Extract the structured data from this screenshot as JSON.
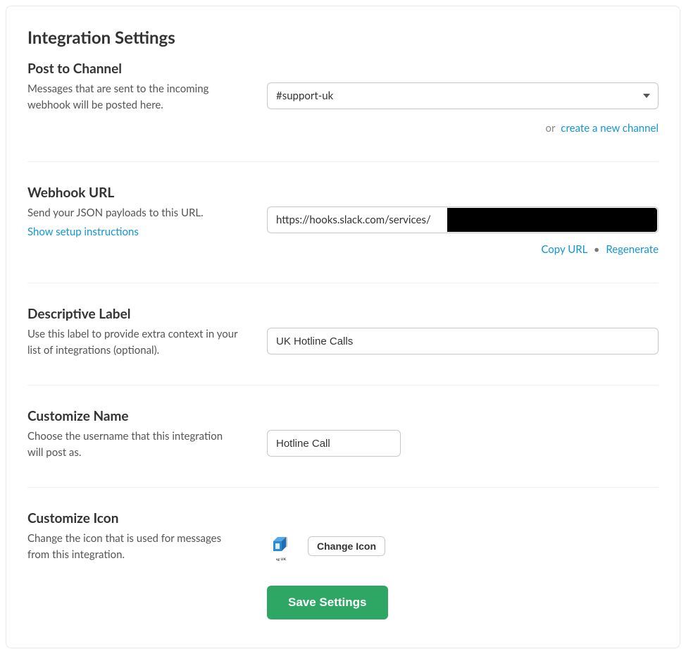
{
  "title": "Integration Settings",
  "post_to_channel": {
    "heading": "Post to Channel",
    "description": "Messages that are sent to the incoming webhook will be posted here.",
    "selected": "#support-uk",
    "or_text": "or",
    "create_link": "create a new channel"
  },
  "webhook_url": {
    "heading": "Webhook URL",
    "description": "Send your JSON payloads to this URL.",
    "show_instructions_link": "Show setup instructions",
    "url_prefix": "https://hooks.slack.com/services/",
    "copy_label": "Copy URL",
    "separator": "•",
    "regenerate_label": "Regenerate"
  },
  "descriptive_label": {
    "heading": "Descriptive Label",
    "description": "Use this label to provide extra context in your list of integrations (optional).",
    "value": "UK Hotline Calls"
  },
  "customize_name": {
    "heading": "Customize Name",
    "description": "Choose the username that this integration will post as.",
    "value": "Hotline Call"
  },
  "customize_icon": {
    "heading": "Customize Icon",
    "description": "Change the icon that is used for messages from this integration.",
    "icon_caption": "sg UK",
    "change_icon_label": "Change Icon"
  },
  "save_button_label": "Save Settings"
}
